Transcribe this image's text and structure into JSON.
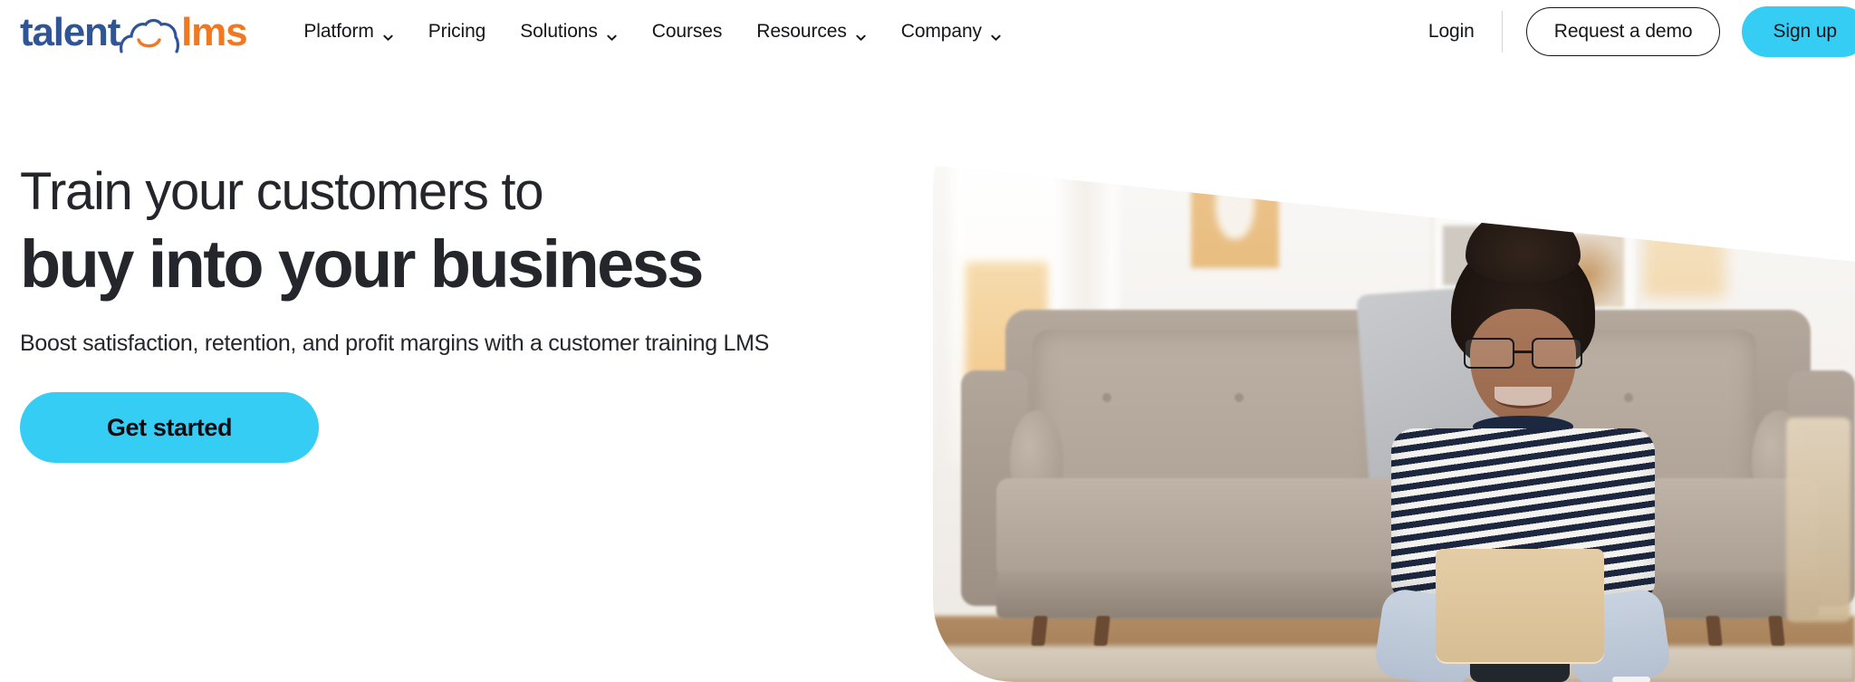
{
  "brand": {
    "name_part_1": "talent",
    "name_part_2": "lms",
    "logo_icon": "cloud-smile-icon",
    "color_blue": "#2f5596",
    "color_orange": "#f07820",
    "accent_cyan": "#35cdf4"
  },
  "header": {
    "nav": [
      {
        "label": "Platform",
        "has_dropdown": true,
        "icon": "chevron-down-icon"
      },
      {
        "label": "Pricing",
        "has_dropdown": false,
        "icon": ""
      },
      {
        "label": "Solutions",
        "has_dropdown": true,
        "icon": "chevron-down-icon"
      },
      {
        "label": "Courses",
        "has_dropdown": false,
        "icon": ""
      },
      {
        "label": "Resources",
        "has_dropdown": true,
        "icon": "chevron-down-icon"
      },
      {
        "label": "Company",
        "has_dropdown": true,
        "icon": "chevron-down-icon"
      }
    ],
    "login_label": "Login",
    "demo_label": "Request a demo",
    "signup_label": "Sign up"
  },
  "hero": {
    "headline_line_1": "Train your customers to",
    "headline_line_2": "buy into your business",
    "subheadline": "Boost satisfaction, retention, and profit margins with a customer training LMS",
    "cta_label": "Get started",
    "image_alt": "Woman with glasses sitting cross-legged on the floor in a living room using a laptop in front of a beige couch"
  }
}
